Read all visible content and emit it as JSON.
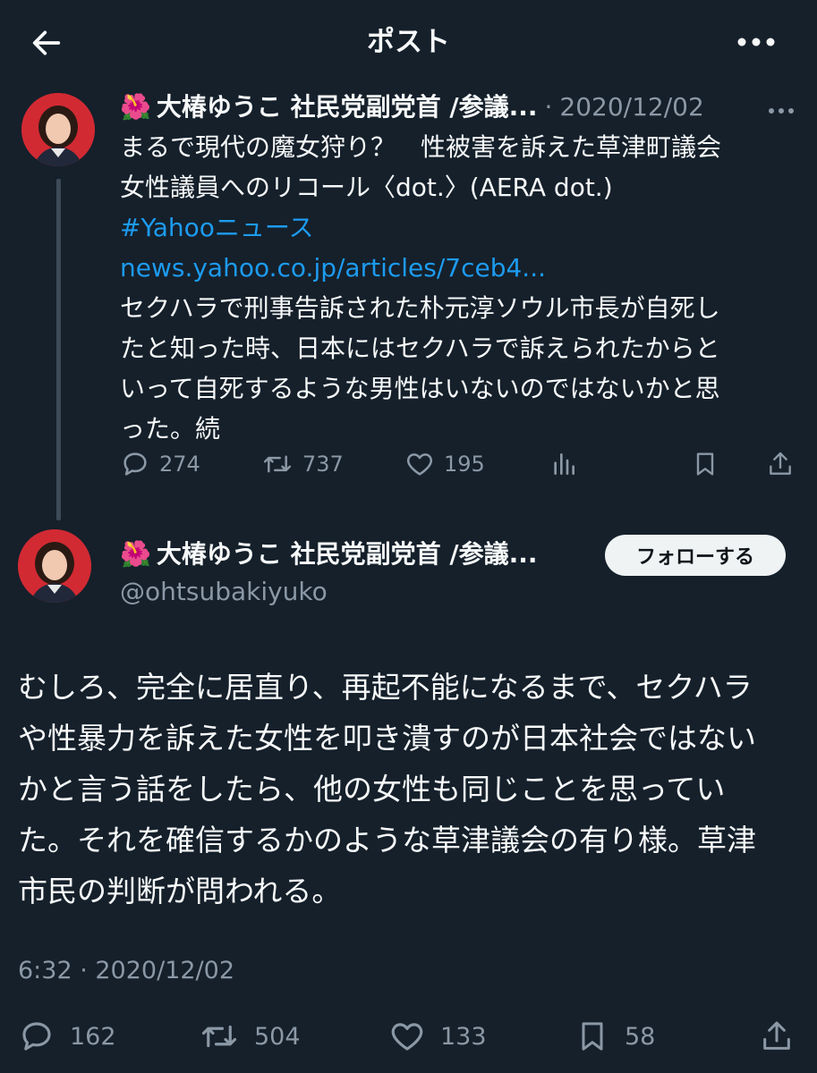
{
  "header": {
    "title": "ポスト"
  },
  "quoted_post": {
    "author_emoji": "🌺",
    "author_name": "大椿ゆうこ 社民党副党首 /参議...",
    "separator": "·",
    "date": "2020/12/02",
    "lines": [
      "まるで現代の魔女狩り？　性被害を訴えた草津町議会",
      "女性議員へのリコール〈dot.〉(AERA dot.)"
    ],
    "hashtag": "#Yahooニュース",
    "url": "news.yahoo.co.jp/articles/7ceb4...",
    "body_lines": [
      "セクハラで刑事告訴された朴元淳ソウル市長が自死し",
      "たと知った時、日本にはセクハラで訴えられたからと",
      "いって自死するような男性はいないのではないかと思",
      "った。続"
    ],
    "stats": {
      "replies": "274",
      "reposts": "737",
      "likes": "195"
    }
  },
  "main_post": {
    "author_emoji": "🌺",
    "author_name": "大椿ゆうこ 社民党副党首 /参議...",
    "handle": "@ohtsubakiyuko",
    "follow_label": "フォローする",
    "body_lines": [
      "むしろ、完全に居直り、再起不能になるまで、セクハラ",
      "や性暴力を訴えた女性を叩き潰すのが日本社会ではない",
      "かと言う話をしたら、他の女性も同じことを思ってい",
      "た。それを確信するかのような草津議会の有り様。草津",
      "市民の判断が問われる。"
    ],
    "timestamp": "6:32 · 2020/12/02",
    "stats": {
      "replies": "162",
      "reposts": "504",
      "likes": "133",
      "bookmarks": "58"
    }
  },
  "icons": [
    "back-arrow-icon",
    "more-icon",
    "reply-icon",
    "repost-icon",
    "like-icon",
    "views-icon",
    "bookmark-icon",
    "share-icon"
  ],
  "colors": {
    "background": "#15202b",
    "link": "#1d9bf0",
    "muted": "#8b98a5",
    "avatar_bg": "#d22a33"
  }
}
